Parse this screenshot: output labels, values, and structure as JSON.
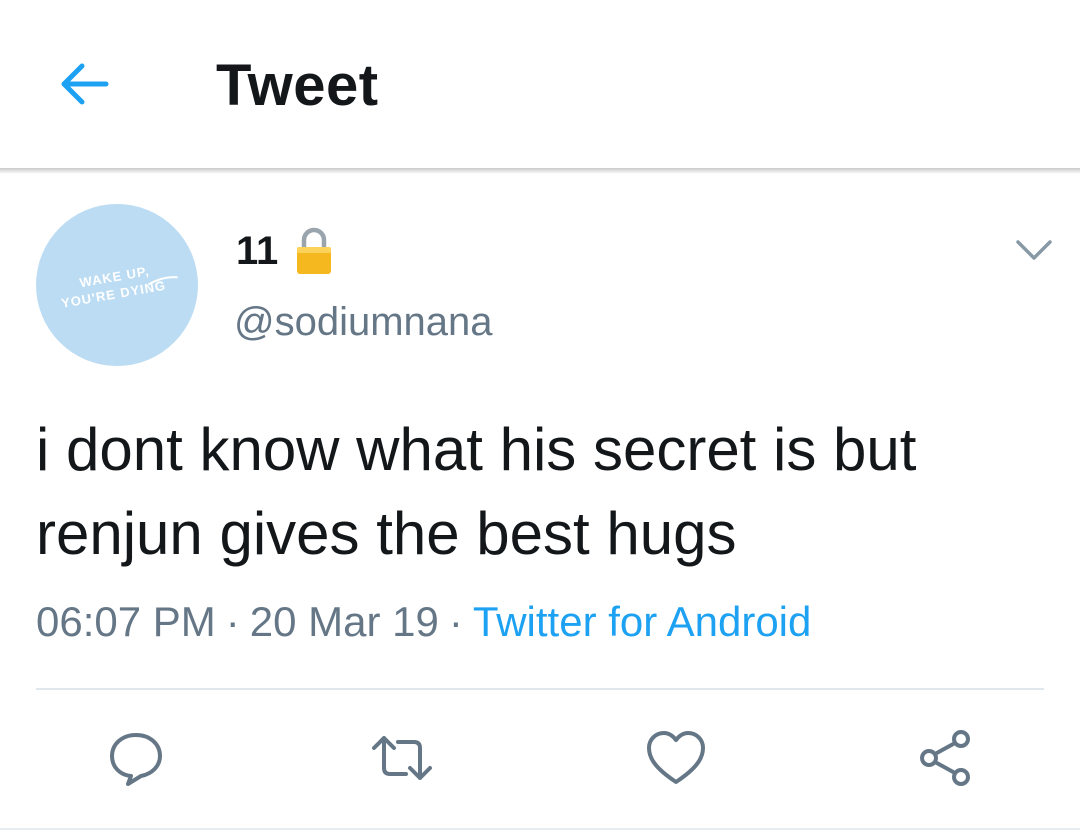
{
  "header": {
    "title": "Tweet",
    "back_icon": "arrow-left-icon",
    "accent_color": "#1da1f2"
  },
  "tweet": {
    "avatar": {
      "background_color": "#bcdcf3",
      "lines": [
        "WAKE UP,",
        "YOU'RE DYING"
      ]
    },
    "user": {
      "display_name": "11",
      "protected_icon": "lock-icon",
      "handle": "@sodiumnana"
    },
    "menu_icon": "chevron-down-icon",
    "text_lines": [
      "i dont know what his secret is but",
      "renjun gives the best hugs"
    ],
    "time": "06:07 PM",
    "separator": "·",
    "date": "20 Mar 19",
    "source": "Twitter for Android"
  },
  "actions": {
    "reply_icon": "reply-icon",
    "retweet_icon": "retweet-icon",
    "like_icon": "heart-icon",
    "share_icon": "share-icon",
    "icon_color": "#657786"
  }
}
